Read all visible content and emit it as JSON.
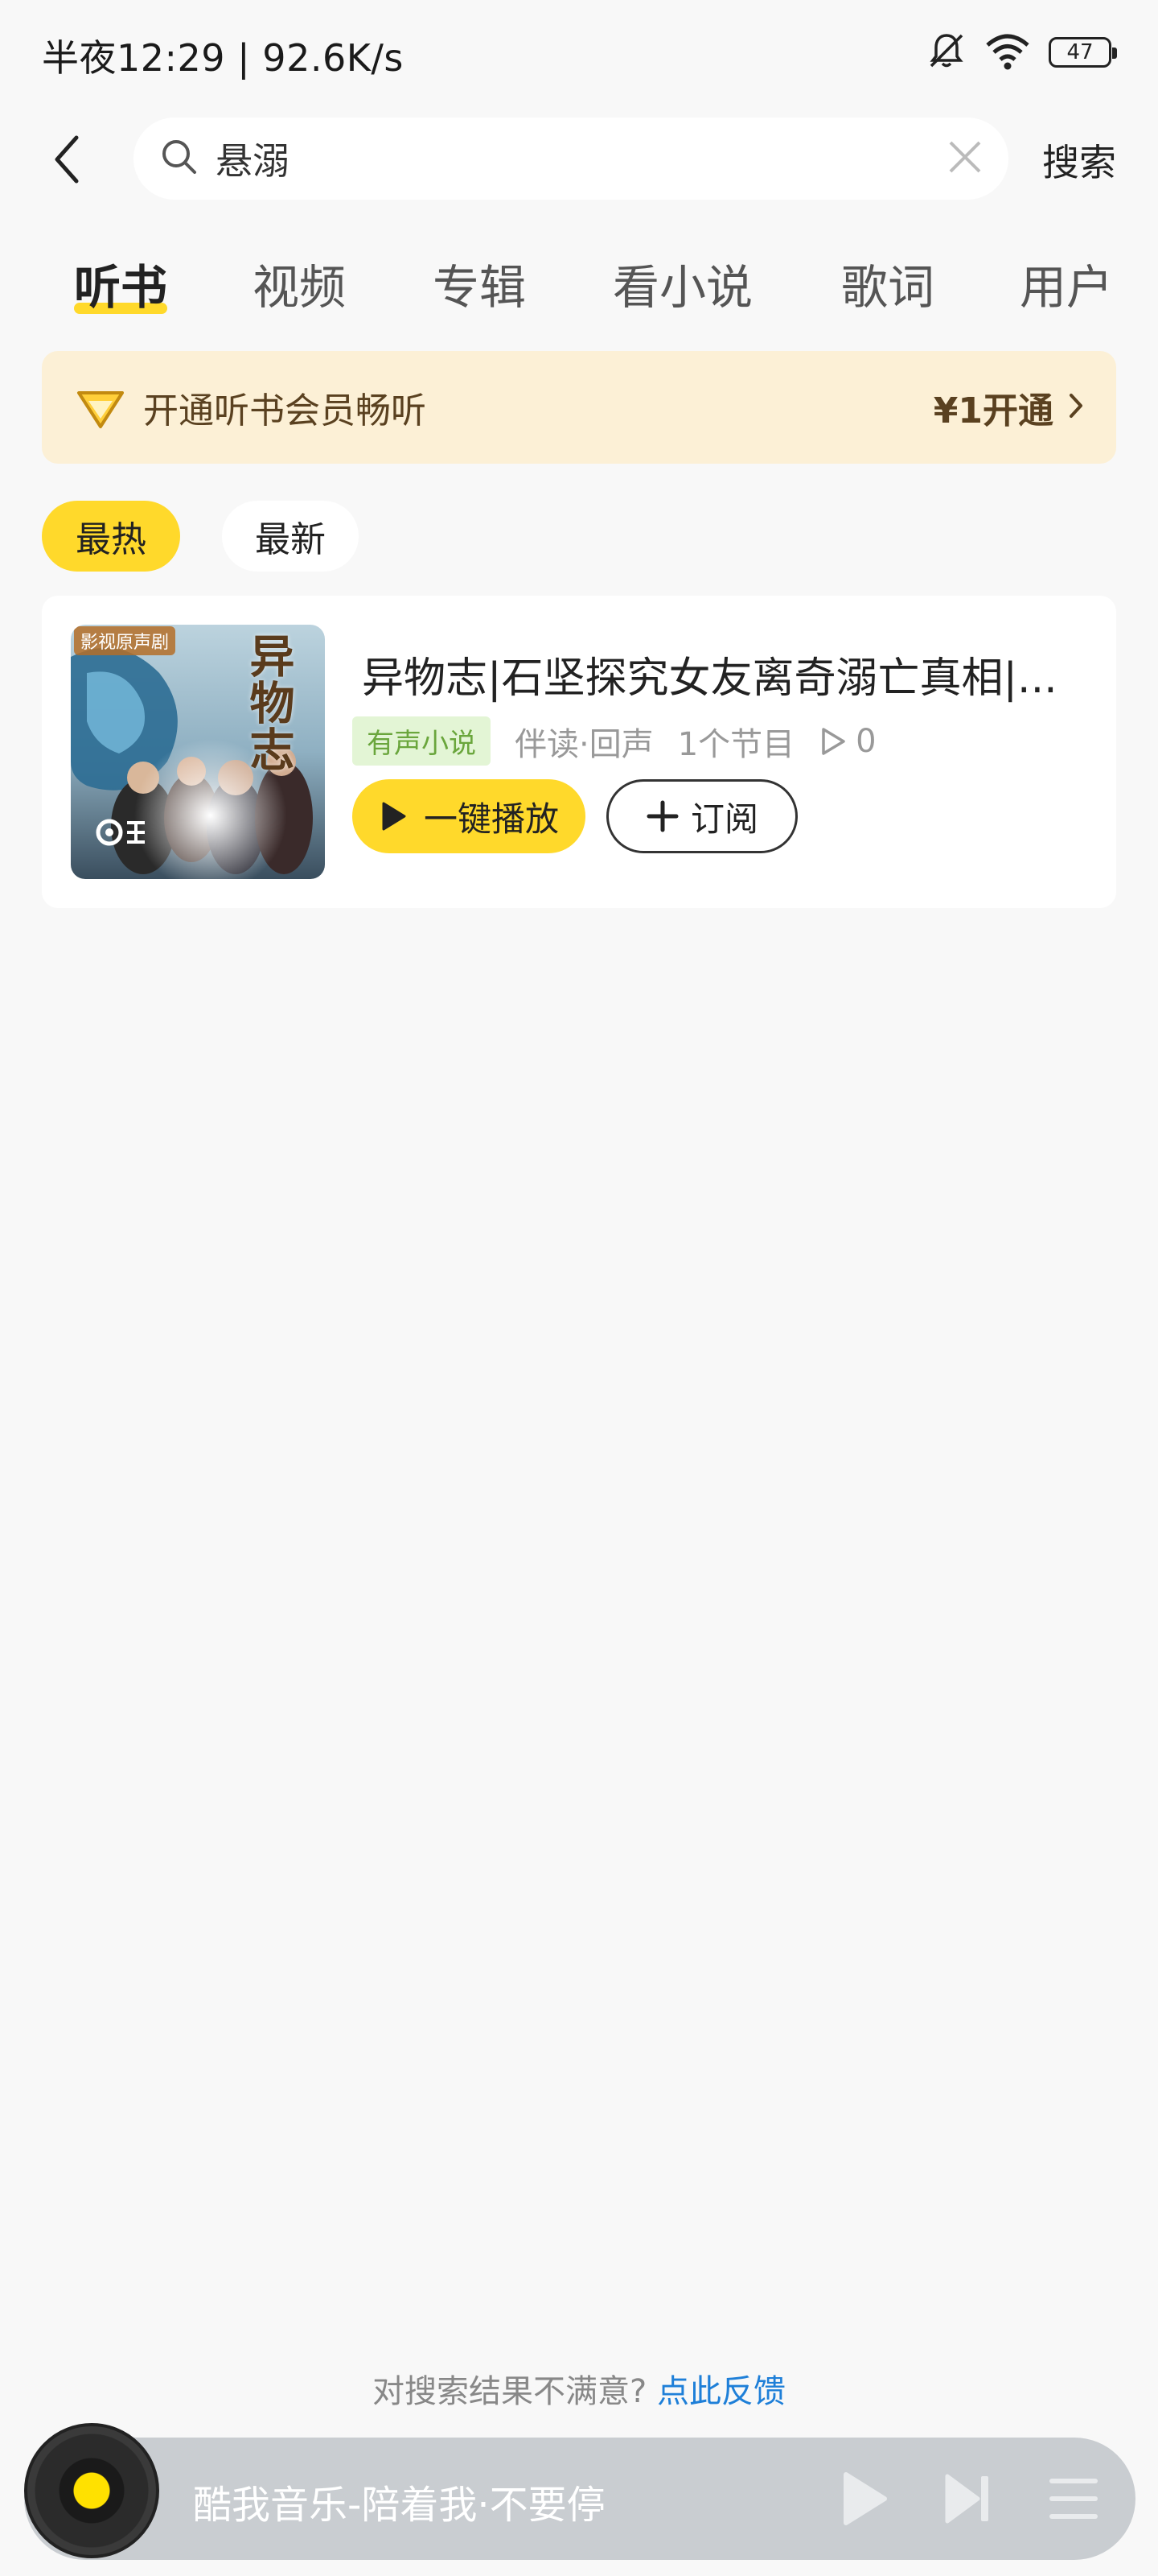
{
  "status_bar": {
    "time_speed": "半夜12:29 | 92.6K/s",
    "battery": "47"
  },
  "search": {
    "value": "悬溺",
    "submit_label": "搜索"
  },
  "tabs": [
    {
      "label": "听书",
      "active": true
    },
    {
      "label": "视频",
      "active": false
    },
    {
      "label": "专辑",
      "active": false
    },
    {
      "label": "看小说",
      "active": false
    },
    {
      "label": "歌词",
      "active": false
    },
    {
      "label": "用户",
      "active": false
    }
  ],
  "vip_banner": {
    "text": "开通听书会员畅听",
    "price": "¥1开通"
  },
  "sort": {
    "hot": "最热",
    "new": "最新"
  },
  "result": {
    "title": "异物志|石坚探究女友离奇溺亡真相|...",
    "type_badge": "有声小说",
    "voice": "伴读·回声",
    "episodes": "1个节目",
    "plays": "0",
    "play_label": "一键播放",
    "subscribe_label": "订阅",
    "cover": {
      "tag": "影视原声剧",
      "title": "异物志"
    }
  },
  "feedback": {
    "text": "对搜索结果不满意?",
    "link": "点此反馈"
  },
  "player": {
    "track": "酷我音乐-陪着我·不要停"
  },
  "colors": {
    "accent": "#ffd92b",
    "vip_bg": "#fcf0d6",
    "link": "#1e7fd8",
    "badge_bg": "#e3f5d5",
    "badge_fg": "#6aa63c"
  }
}
